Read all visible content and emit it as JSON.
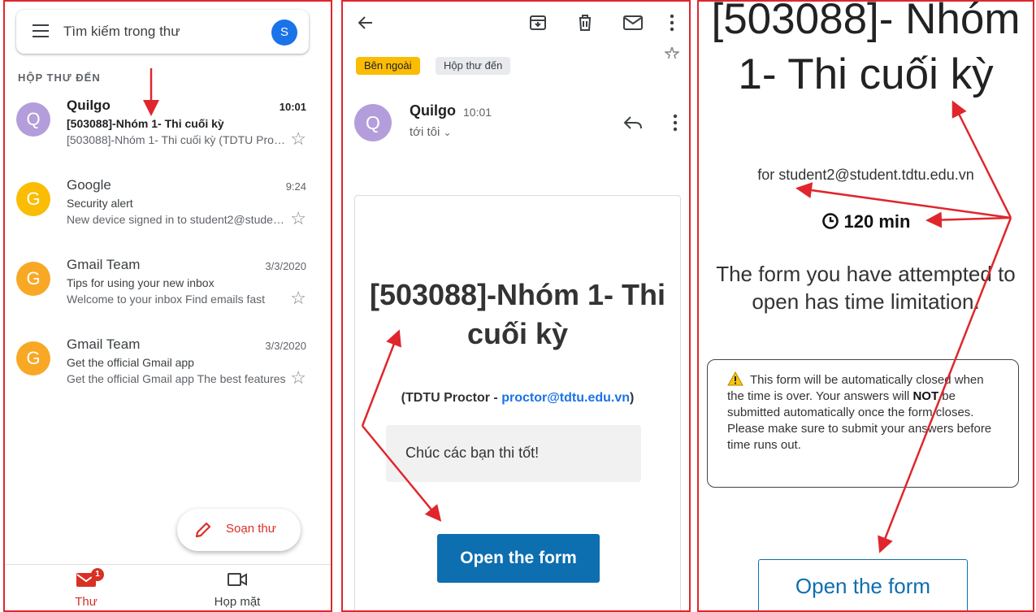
{
  "inbox": {
    "search_placeholder": "Tìm kiếm trong thư",
    "account_initial": "S",
    "section_label": "HỘP THƯ ĐẾN",
    "messages": [
      {
        "initial": "Q",
        "avatar_color": "#b39ddb",
        "sender": "Quilgo",
        "time": "10:01",
        "subject": "[503088]-Nhóm 1- Thi cuối kỳ",
        "snippet": "[503088]-Nhóm 1- Thi cuối kỳ (TDTU Proctor - proctor@tdtu.edu.vn)",
        "unread": true
      },
      {
        "initial": "G",
        "avatar_color": "#fbbc04",
        "sender": "Google",
        "time": "9:24",
        "subject": "Security alert",
        "snippet": "New device signed in to student2@student.tdtu.edu.vn",
        "unread": false
      },
      {
        "initial": "G",
        "avatar_color": "#f9a825",
        "sender": "Gmail Team",
        "time": "3/3/2020",
        "subject": "Tips for using your new inbox",
        "snippet": "Welcome to your inbox Find emails fast",
        "unread": false
      },
      {
        "initial": "G",
        "avatar_color": "#f9a825",
        "sender": "Gmail Team",
        "time": "3/3/2020",
        "subject": "Get the official Gmail app",
        "snippet": "Get the official Gmail app The best features",
        "unread": false
      }
    ],
    "compose_label": "Soạn thư",
    "nav": {
      "mail_label": "Thư",
      "mail_badge": "1",
      "meet_label": "Họp mặt"
    }
  },
  "message": {
    "tags": {
      "external": "Bên ngoài",
      "inbox": "Hộp thư đến"
    },
    "sender_initial": "Q",
    "sender": "Quilgo",
    "time": "10:01",
    "to": "tới tôi",
    "title": "[503088]-Nhóm 1- Thi cuối kỳ",
    "sub_prefix": "(TDTU Proctor - ",
    "sub_link": "proctor@tdtu.edu.vn",
    "sub_suffix": ")",
    "wish": "Chúc các bạn thi tốt!",
    "open_button": "Open the form"
  },
  "form": {
    "title": "[503088]- Nhóm 1- Thi cuối kỳ",
    "for_line": "for student2@student.tdtu.edu.vn",
    "timer": "120 min",
    "message": "The form you have attempted to open has time limitation.",
    "notice_1": "This form will be automatically closed when the time is over. Your answers will ",
    "notice_bold": "NOT",
    "notice_2": " be submitted automatically once the form closes. Please make sure to submit your answers before time runs out.",
    "open_button": "Open the form"
  },
  "colors": {
    "frame": "#e0262c",
    "arrow": "#e0262c",
    "form_blue": "#0d6eb0",
    "gmail_red": "#d93025"
  }
}
